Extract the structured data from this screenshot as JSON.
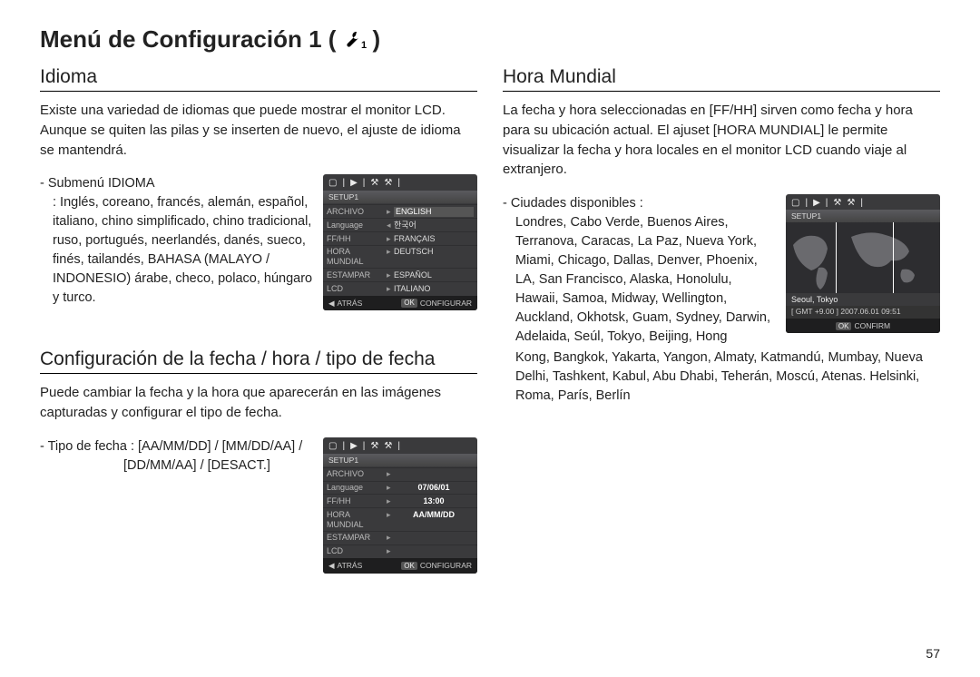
{
  "page_title_prefix": "Menú de Configuración 1 (",
  "page_title_suffix": ")",
  "title_icon_name": "wrench-1-icon",
  "page_number": "57",
  "left": {
    "section1": {
      "title": "Idioma",
      "intro": "Existe una variedad de idiomas que puede mostrar el monitor LCD. Aunque se quiten las pilas y se inserten de nuevo, el ajuste de idioma se mantendrá.",
      "sub_heading": "- Submenú IDIOMA",
      "sub_body": ": Inglés, coreano, francés, alemán, español, italiano, chino simplificado, chino tradicional, ruso, portugués, neerlandés, danés, sueco, finés, tailandés, BAHASA (MALAYO / INDONESIO) árabe, checo, polaco, húngaro y turco."
    },
    "section2": {
      "title": "Configuración de la fecha / hora / tipo de fecha",
      "intro": "Puede cambiar la fecha y la hora que aparecerán en las imágenes capturadas y configurar el tipo de fecha.",
      "sub_heading": "- Tipo de fecha : [AA/MM/DD] / [MM/DD/AA] /",
      "sub_body": "[DD/MM/AA] / [DESACT.]"
    },
    "lcd1": {
      "setup_label": "SETUP1",
      "rows": [
        {
          "l": "ARCHIVO",
          "r": "ENGLISH",
          "hi": true
        },
        {
          "l": "Language",
          "r": "한국어"
        },
        {
          "l": "FF/HH",
          "r": "FRANÇAIS"
        },
        {
          "l": "HORA MUNDIAL",
          "r": "DEUTSCH"
        },
        {
          "l": "ESTAMPAR",
          "r": "ESPAÑOL"
        },
        {
          "l": "LCD",
          "r": "ITALIANO"
        }
      ],
      "footer": {
        "back": "ATRÁS",
        "ok": "OK",
        "set": "CONFIGURAR"
      }
    },
    "lcd2": {
      "setup_label": "SETUP1",
      "rows": [
        {
          "l": "ARCHIVO",
          "r": ""
        },
        {
          "l": "Language",
          "r": "07/06/01",
          "bold": true
        },
        {
          "l": "FF/HH",
          "r": "13:00",
          "bold": true
        },
        {
          "l": "HORA MUNDIAL",
          "r": "AA/MM/DD",
          "bold": true
        },
        {
          "l": "ESTAMPAR",
          "r": ""
        },
        {
          "l": "LCD",
          "r": ""
        }
      ],
      "footer": {
        "back": "ATRÁS",
        "ok": "OK",
        "set": "CONFIGURAR"
      }
    }
  },
  "right": {
    "section": {
      "title": "Hora Mundial",
      "intro": "La fecha y hora seleccionadas en [FF/HH] sirven como fecha y hora para su ubicación actual. El ajuset [HORA MUNDIAL] le permite visualizar la fecha y hora locales en el monitor LCD cuando viaje al extranjero.",
      "sub_heading": "- Ciudades disponibles :",
      "cities_block": "Londres, Cabo Verde, Buenos Aires, Terranova, Caracas, La Paz, Nueva York, Miami, Chicago, Dallas, Denver, Phoenix, LA, San Francisco, Alaska, Honolulu, Hawaii, Samoa, Midway, Wellington, Auckland, Okhotsk, Guam, Sydney, Darwin, Adelaida, Seúl, Tokyo, Beijing, Hong",
      "cities_cont": "Kong, Bangkok, Yakarta, Yangon, Almaty, Katmandú, Mumbay, Nueva Delhi, Tashkent, Kabul, Abu Dhabi, Teherán, Moscú, Atenas. Helsinki, Roma, París, Berlín"
    },
    "lcd": {
      "setup_label": "SETUP1",
      "city": "Seoul, Tokyo",
      "gmt": "[ GMT +9.00 ]    2007.06.01    09:51",
      "footer": {
        "ok": "OK",
        "confirm": "CONFIRM"
      }
    }
  }
}
